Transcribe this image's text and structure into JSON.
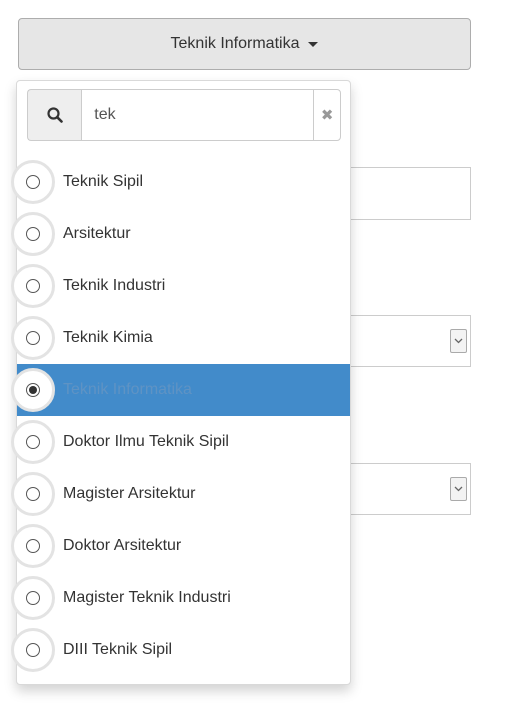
{
  "toggle": {
    "label": "Teknik Informatika"
  },
  "search": {
    "value": "tek",
    "clear_symbol": "✖"
  },
  "options": [
    {
      "label": "Teknik Sipil",
      "selected": false
    },
    {
      "label": "Arsitektur",
      "selected": false
    },
    {
      "label": "Teknik Industri",
      "selected": false
    },
    {
      "label": "Teknik Kimia",
      "selected": false
    },
    {
      "label": "Teknik Informatika",
      "selected": true
    },
    {
      "label": "Doktor Ilmu Teknik Sipil",
      "selected": false
    },
    {
      "label": "Magister Arsitektur",
      "selected": false
    },
    {
      "label": "Doktor Arsitektur",
      "selected": false
    },
    {
      "label": "Magister Teknik Industri",
      "selected": false
    },
    {
      "label": "DIII Teknik Sipil",
      "selected": false
    }
  ],
  "icons": {
    "search": "search-icon",
    "clear": "close-icon",
    "caret": "caret-down-icon",
    "select_arrow": "chevron-down-icon"
  },
  "colors": {
    "active_bg": "#428bca",
    "button_bg": "#e6e6e6"
  }
}
